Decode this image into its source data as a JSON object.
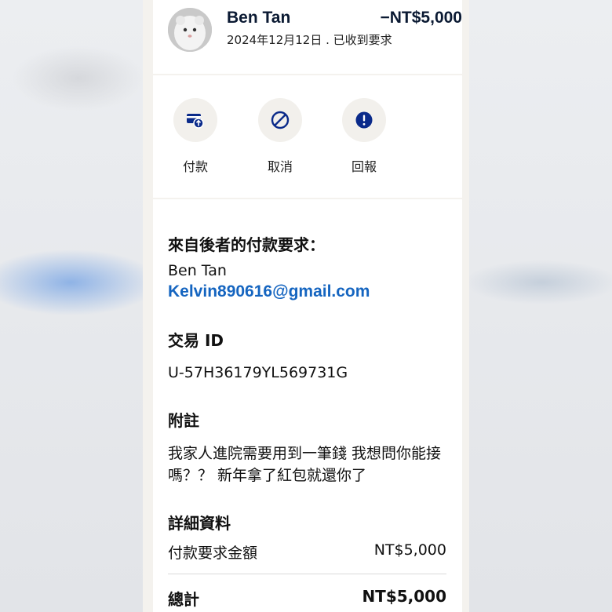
{
  "header": {
    "name": "Ben Tan",
    "amount": "−NT$5,000",
    "date_status": "2024年12月12日 . 已收到要求"
  },
  "actions": [
    {
      "label": "付款",
      "icon": "pay-icon"
    },
    {
      "label": "取消",
      "icon": "cancel-icon"
    },
    {
      "label": "回報",
      "icon": "report-icon"
    }
  ],
  "details": {
    "request_from_label": "來自後者的付款要求：",
    "requester_name": "Ben Tan",
    "requester_email": "Kelvin890616@gmail.com",
    "transaction_id_label": "交易 ID",
    "transaction_id": "U-57H36179YL569731G",
    "note_label": "附註",
    "note_text": "我家人進院需要用到一筆錢 我想問你能接嗎？？ 新年拿了紅包就還你了",
    "details_label": "詳細資料",
    "request_amount_label": "付款要求金額",
    "request_amount": "NT$5,000",
    "total_label": "總計",
    "total_amount": "NT$5,000"
  },
  "colors": {
    "brand_navy": "#0b1a33",
    "link_blue": "#1565c0",
    "icon_navy": "#0a2a8a"
  }
}
